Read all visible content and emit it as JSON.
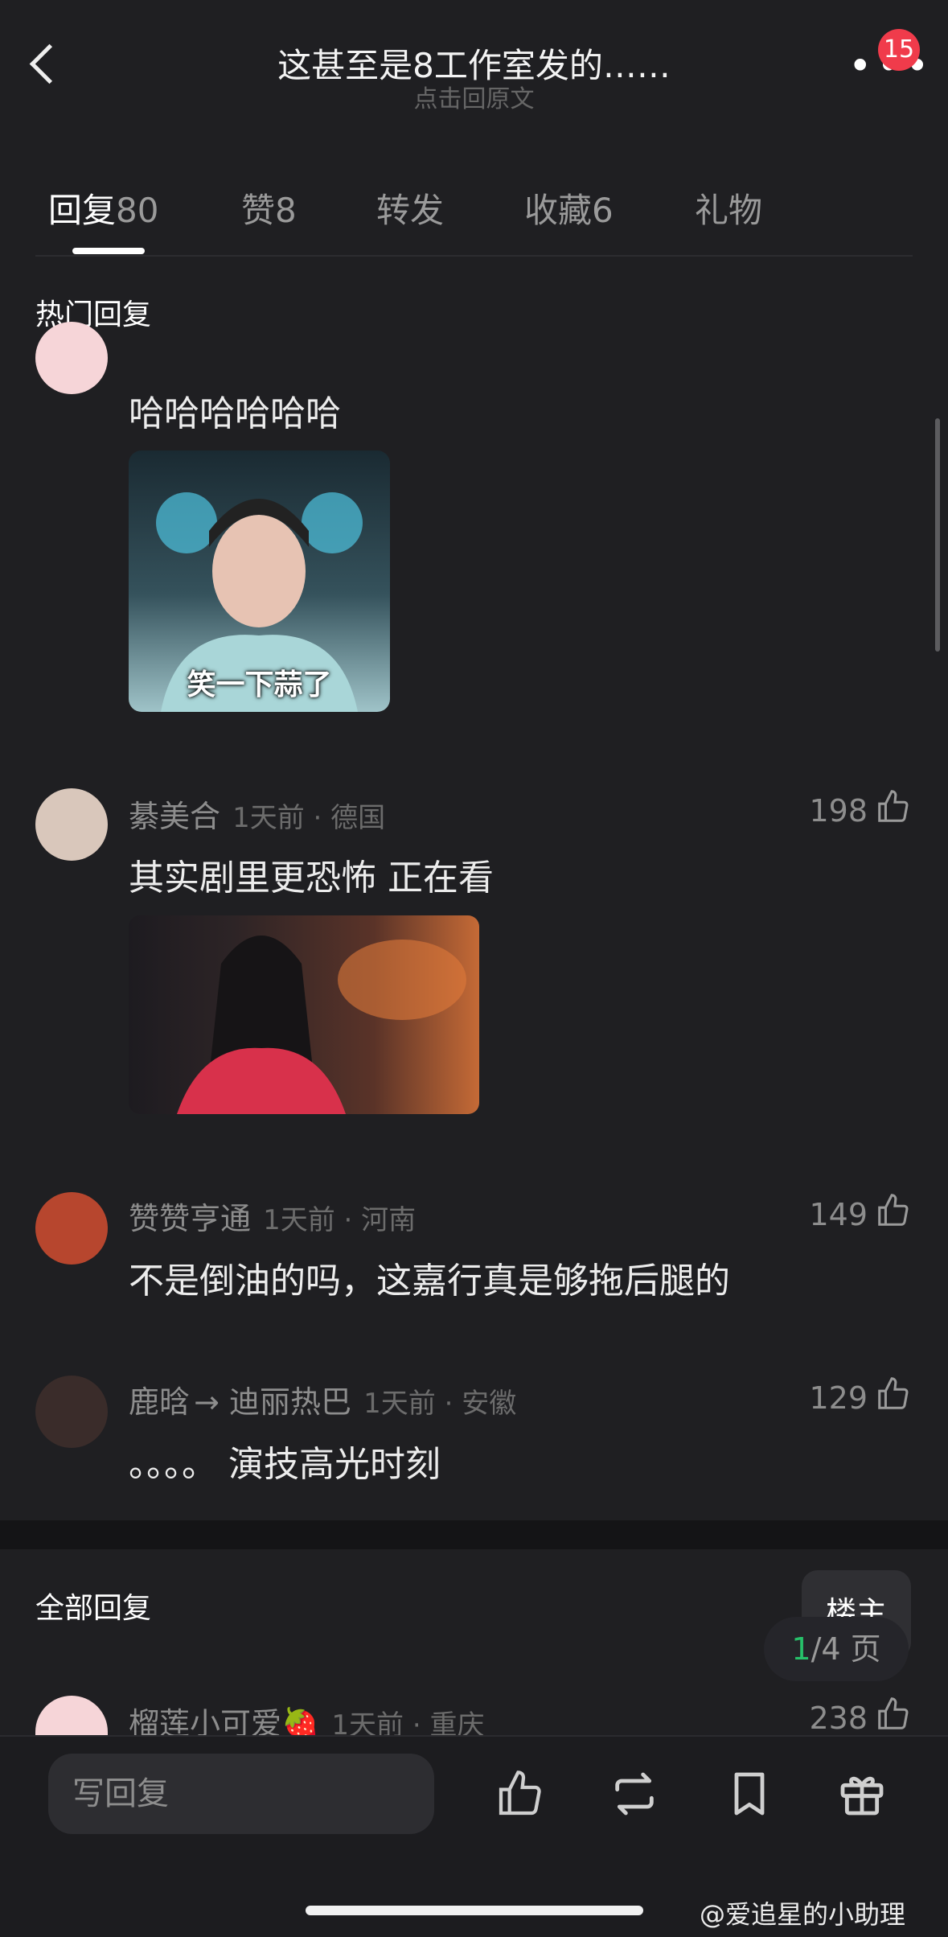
{
  "header": {
    "title": "这甚至是8工作室发的……",
    "subtitle": "点击回原文",
    "notification_count": "15"
  },
  "tabs": [
    {
      "label": "回复",
      "count": "80"
    },
    {
      "label": "赞",
      "count": "8"
    },
    {
      "label": "转发",
      "count": ""
    },
    {
      "label": "收藏",
      "count": "6"
    },
    {
      "label": "礼物",
      "count": ""
    }
  ],
  "hot_section": {
    "title": "热门回复"
  },
  "comments": [
    {
      "text": "哈哈哈哈哈哈",
      "image_caption": "笑一下蒜了"
    },
    {
      "user": "綦美合",
      "time_loc": "1天前 · 德国",
      "likes": "198",
      "text": "其实剧里更恐怖 正在看"
    },
    {
      "user": "赞赞亨通",
      "time_loc": "1天前 · 河南",
      "likes": "149",
      "text": "不是倒油的吗，这嘉行真是够拖后腿的"
    },
    {
      "user": "鹿晗",
      "user_target": "迪丽热巴",
      "time_loc": "1天前 · 安徽",
      "likes": "129",
      "text": "。。。。 演技高光时刻"
    }
  ],
  "all_section": {
    "title": "全部回复",
    "floor_button": "楼主"
  },
  "pager": {
    "current": "1",
    "total": "/4 页"
  },
  "all_comments": [
    {
      "user": "榴莲小可爱🍓",
      "time_loc": "1天前 · 重庆",
      "likes": "238"
    }
  ],
  "bottom": {
    "reply_placeholder": "写回复"
  },
  "watermark": "@爱追星的小助理",
  "colors": {
    "background": "#1f1f22",
    "badge": "#f03b4b",
    "pager_current": "#27c06a"
  }
}
